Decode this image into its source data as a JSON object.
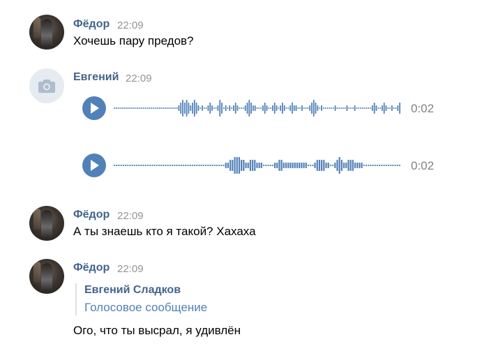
{
  "messages": [
    {
      "author": "Фёдор",
      "time": "22:09",
      "text": "Хочешь пару предов?"
    },
    {
      "author": "Евгений",
      "time": "22:09",
      "avatar_icon": "camera-icon",
      "voice_messages": [
        {
          "duration": "0:02",
          "waveform": [
            1,
            1,
            1,
            1,
            1,
            1,
            1,
            1,
            1,
            1,
            1,
            1,
            1,
            1,
            1,
            1,
            1,
            1,
            1,
            1,
            1,
            1,
            1,
            1,
            1,
            1,
            1,
            1,
            1,
            1,
            1,
            1,
            1,
            2,
            3,
            4,
            3,
            4,
            3,
            2,
            3,
            4,
            3,
            2,
            1,
            2,
            1,
            1,
            2,
            3,
            2,
            1,
            1,
            2,
            4,
            3,
            1,
            2,
            1,
            2,
            1,
            2,
            3,
            2,
            1,
            1,
            1,
            2,
            3,
            4,
            3,
            2,
            2,
            1,
            1,
            1,
            2,
            3,
            2,
            1,
            1,
            2,
            3,
            2,
            1,
            2,
            3,
            2,
            1,
            1,
            2,
            3,
            2,
            2,
            1,
            1,
            2,
            1,
            1,
            1,
            2,
            3,
            4,
            3,
            2,
            1,
            2,
            1,
            1,
            1,
            1,
            1,
            1,
            2,
            1,
            1,
            1,
            1,
            1,
            2,
            1,
            1,
            1,
            2,
            1,
            1,
            1,
            1,
            1,
            1,
            1,
            1,
            2,
            3,
            2,
            1,
            1,
            2,
            3,
            2,
            1,
            1,
            2,
            1,
            1,
            2,
            3
          ]
        },
        {
          "duration": "0:02",
          "waveform": [
            1,
            1,
            1,
            1,
            1,
            1,
            1,
            1,
            1,
            1,
            1,
            1,
            1,
            1,
            1,
            1,
            1,
            1,
            1,
            1,
            1,
            1,
            1,
            1,
            1,
            1,
            1,
            1,
            1,
            1,
            1,
            1,
            1,
            1,
            1,
            1,
            1,
            1,
            1,
            1,
            1,
            1,
            1,
            1,
            1,
            1,
            1,
            1,
            1,
            1,
            2,
            2,
            3,
            3,
            4,
            4,
            4,
            3,
            3,
            2,
            2,
            3,
            3,
            3,
            2,
            2,
            2,
            1,
            1,
            1,
            1,
            1,
            2,
            2,
            3,
            3,
            2,
            2,
            2,
            2,
            2,
            2,
            2,
            2,
            2,
            2,
            2,
            1,
            1,
            1,
            2,
            3,
            3,
            3,
            3,
            2,
            2,
            1,
            1,
            2,
            3,
            4,
            3,
            2,
            2,
            3,
            3,
            3,
            2,
            2,
            2,
            2,
            1,
            1,
            1,
            1,
            1,
            1,
            1,
            1,
            1,
            1,
            1,
            1,
            1,
            1,
            1,
            1,
            1
          ]
        }
      ]
    },
    {
      "author": "Фёдор",
      "time": "22:09",
      "text": "А ты знаешь кто я такой? Хахаха"
    },
    {
      "author": "Фёдор",
      "time": "22:09",
      "quote": {
        "author": "Евгений Сладков",
        "text": "Голосовое сообщение"
      },
      "text": "Ого, что ты высрал, я удивлён"
    }
  ],
  "colors": {
    "author": "#42648b",
    "time": "#939393",
    "play_button": "#5181b8",
    "waveform": "#5181b8",
    "duration": "#828282",
    "quote_text": "#5181b8",
    "quote_border": "#dbe1e8"
  }
}
